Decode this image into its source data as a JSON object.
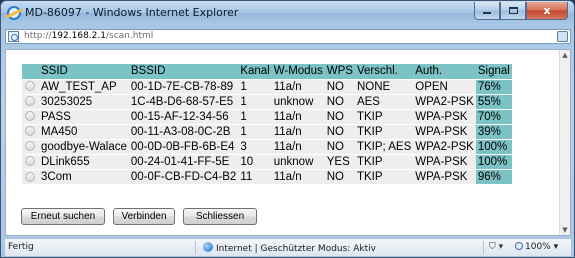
{
  "window": {
    "title": "MD-86097 - Windows Internet Explorer",
    "close_glyph": "x"
  },
  "address": {
    "url_prefix": "http://",
    "url_host": "192.168.2.1",
    "url_path": "/scan.html"
  },
  "table": {
    "headers": [
      "SSID",
      "BSSID",
      "Kanal",
      "W-Modus",
      "WPS",
      "Verschl.",
      "Auth.",
      "Signal"
    ],
    "rows": [
      [
        "AW_TEST_AP",
        "00-1D-7E-CB-78-89",
        "1",
        "11a/n",
        "NO",
        "NONE",
        "OPEN",
        "76%"
      ],
      [
        "30253025",
        "1C-4B-D6-68-57-E5",
        "1",
        "unknow",
        "NO",
        "AES",
        "WPA2-PSK",
        "55%"
      ],
      [
        "PASS",
        "00-15-AF-12-34-56",
        "1",
        "11a/n",
        "NO",
        "TKIP",
        "WPA-PSK",
        "70%"
      ],
      [
        "MA450",
        "00-11-A3-08-0C-2B",
        "1",
        "11a/n",
        "NO",
        "TKIP",
        "WPA-PSK",
        "39%"
      ],
      [
        "goodbye-Walace",
        "00-0D-0B-FB-6B-E4",
        "3",
        "11a/n",
        "NO",
        "TKIP; AES",
        "WPA2-PSK",
        "100%"
      ],
      [
        "DLink655",
        "00-24-01-41-FF-5E",
        "10",
        "unknow",
        "YES",
        "TKIP",
        "WPA-PSK",
        "100%"
      ],
      [
        "3Com",
        "00-0F-CB-FD-C4-B2",
        "11",
        "11a/n",
        "NO",
        "TKIP",
        "WPA-PSK",
        "96%"
      ]
    ]
  },
  "buttons": {
    "rescan": "Erneut suchen",
    "connect": "Verbinden",
    "close": "Schliessen"
  },
  "status": {
    "left": "Fertig",
    "zone": "Internet | Geschützter Modus: Aktiv",
    "zoom": "100%"
  },
  "colors": {
    "header_bg": "#7cc3c5",
    "row_bg": "#eeeeee",
    "signal_bg": "#7cc3c5"
  }
}
